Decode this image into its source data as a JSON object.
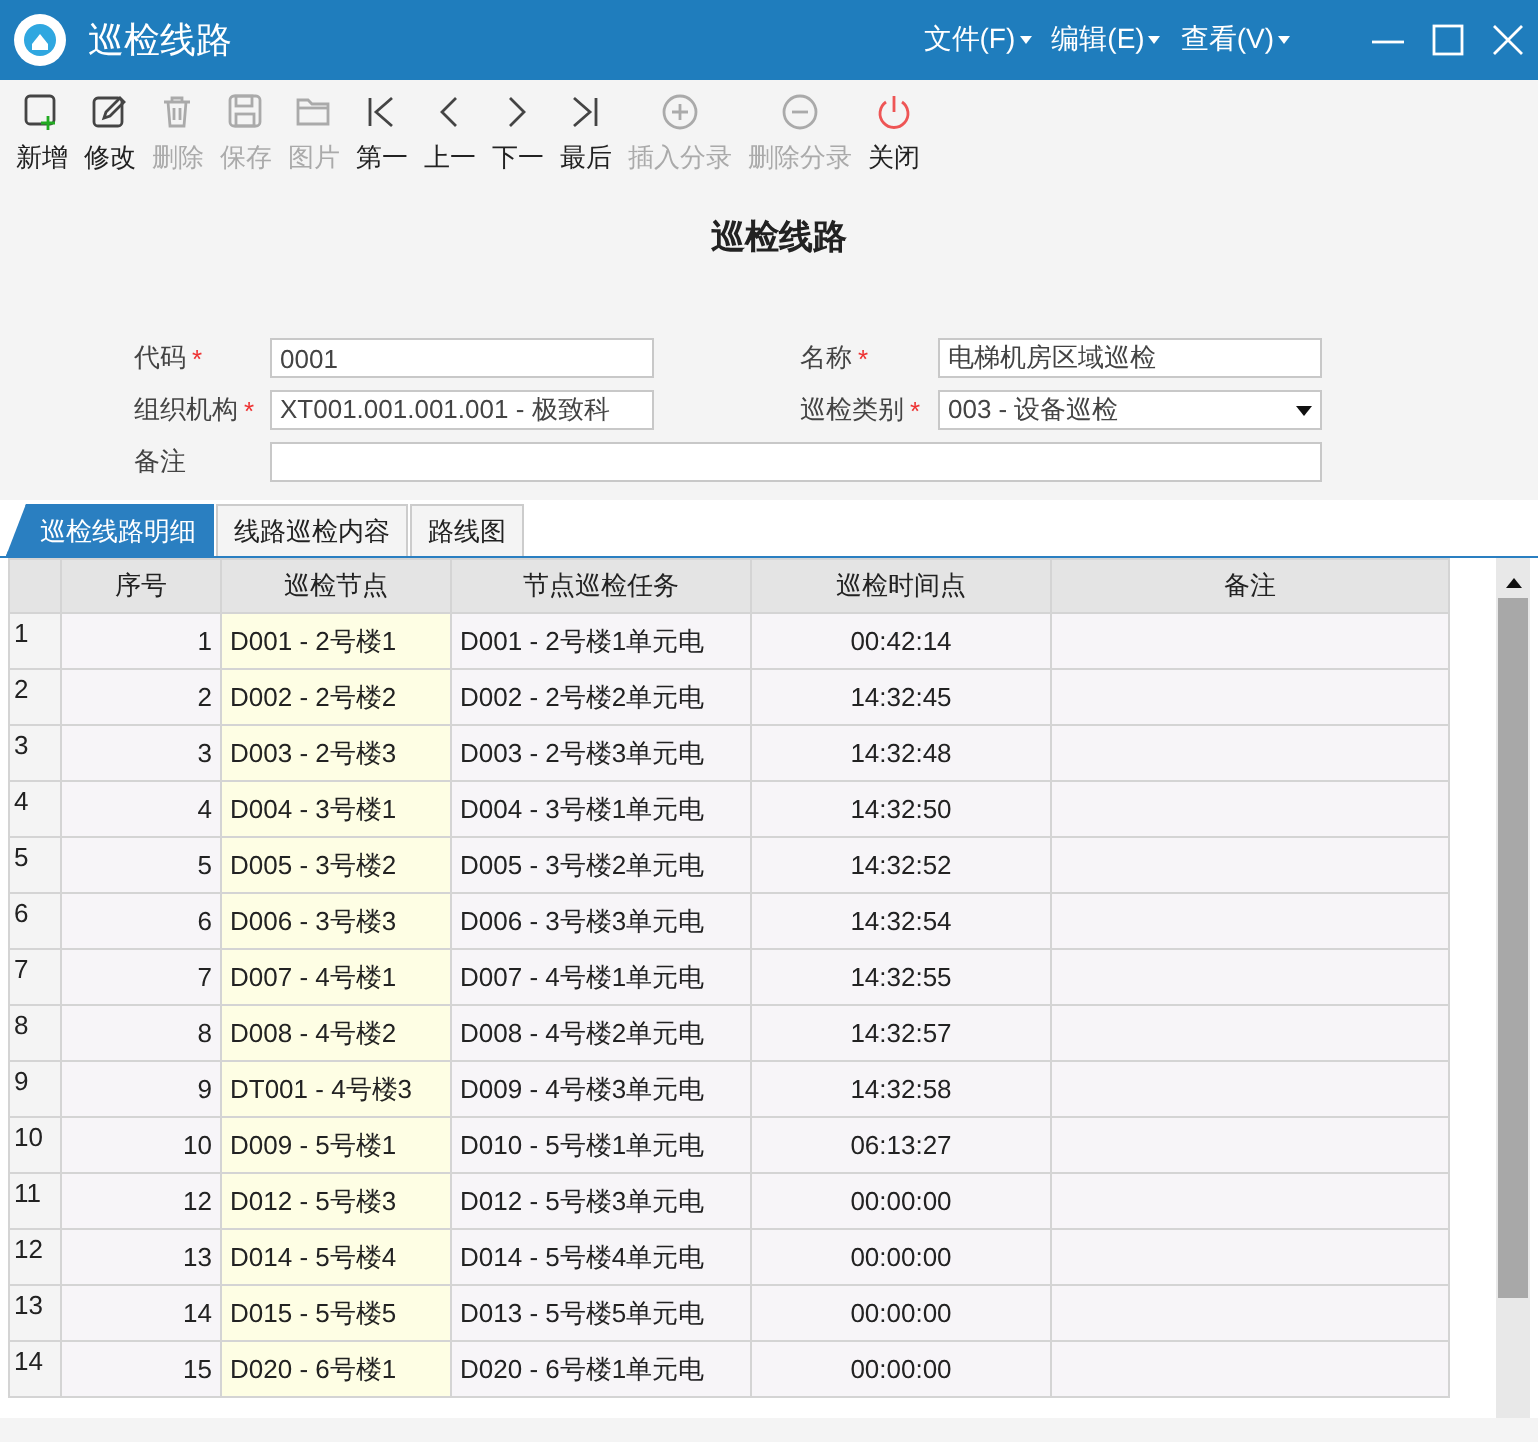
{
  "window": {
    "title": "巡检线路",
    "menus": [
      "文件(F)",
      "编辑(E)",
      "查看(V)"
    ]
  },
  "toolbar": [
    {
      "label": "新增",
      "disabled": false
    },
    {
      "label": "修改",
      "disabled": false
    },
    {
      "label": "删除",
      "disabled": true
    },
    {
      "label": "保存",
      "disabled": true
    },
    {
      "label": "图片",
      "disabled": true
    },
    {
      "label": "第一",
      "disabled": false
    },
    {
      "label": "上一",
      "disabled": false
    },
    {
      "label": "下一",
      "disabled": false
    },
    {
      "label": "最后",
      "disabled": false
    },
    {
      "label": "插入分录",
      "disabled": true
    },
    {
      "label": "删除分录",
      "disabled": true
    },
    {
      "label": "关闭",
      "disabled": false
    }
  ],
  "heading": "巡检线路",
  "form": {
    "fields": [
      {
        "label": "代码",
        "required_mark": "*",
        "value": "0001",
        "kind": "text"
      },
      {
        "label": "名称",
        "required_mark": "*",
        "value": "电梯机房区域巡检",
        "kind": "text"
      },
      {
        "label": "组织机构",
        "required_mark": "*",
        "value": "XT001.001.001.001  - 极致科",
        "kind": "text"
      },
      {
        "label": "巡检类别",
        "required_mark": "*",
        "value": "003 - 设备巡检",
        "kind": "select"
      },
      {
        "label": "备注",
        "kind": "wide"
      }
    ]
  },
  "tabs": [
    {
      "label": "巡检线路明细",
      "selected": true
    },
    {
      "label": "线路巡检内容",
      "selected": false
    },
    {
      "label": "路线图",
      "selected": false
    }
  ],
  "table": {
    "columns": [
      "序号",
      "巡检节点",
      "节点巡检任务",
      "巡检时间点",
      "备注"
    ],
    "rows": [
      {
        "row_header": "1",
        "seq": "1",
        "node": "D001 - 2号楼1",
        "task": "D001 - 2号楼1单元电",
        "time": "00:42:14"
      },
      {
        "row_header": "2",
        "seq": "2",
        "node": "D002 - 2号楼2",
        "task": "D002 - 2号楼2单元电",
        "time": "14:32:45"
      },
      {
        "row_header": "3",
        "seq": "3",
        "node": "D003 - 2号楼3",
        "task": "D003 - 2号楼3单元电",
        "time": "14:32:48"
      },
      {
        "row_header": "4",
        "seq": "4",
        "node": "D004 - 3号楼1",
        "task": "D004 - 3号楼1单元电",
        "time": "14:32:50"
      },
      {
        "row_header": "5",
        "seq": "5",
        "node": "D005 - 3号楼2",
        "task": "D005 - 3号楼2单元电",
        "time": "14:32:52"
      },
      {
        "row_header": "6",
        "seq": "6",
        "node": "D006 - 3号楼3",
        "task": "D006 - 3号楼3单元电",
        "time": "14:32:54"
      },
      {
        "row_header": "7",
        "seq": "7",
        "node": "D007 - 4号楼1",
        "task": "D007 - 4号楼1单元电",
        "time": "14:32:55"
      },
      {
        "row_header": "8",
        "seq": "8",
        "node": "D008 - 4号楼2",
        "task": "D008 - 4号楼2单元电",
        "time": "14:32:57"
      },
      {
        "row_header": "9",
        "seq": "9",
        "node": "DT001 - 4号楼3",
        "task": "D009 - 4号楼3单元电",
        "time": "14:32:58"
      },
      {
        "row_header": "10",
        "seq": "10",
        "node": "D009 - 5号楼1",
        "task": "D010 - 5号楼1单元电",
        "time": "06:13:27"
      },
      {
        "row_header": "11",
        "seq": "12",
        "node": "D012 - 5号楼3",
        "task": "D012 - 5号楼3单元电",
        "time": "00:00:00"
      },
      {
        "row_header": "12",
        "seq": "13",
        "node": "D014 - 5号楼4",
        "task": "D014 - 5号楼4单元电",
        "time": "00:00:00"
      },
      {
        "row_header": "13",
        "seq": "14",
        "node": "D015 - 5号楼5",
        "task": "D013 - 5号楼5单元电",
        "time": "00:00:00"
      },
      {
        "row_header": "14",
        "seq": "15",
        "node": "D020 - 6号楼1",
        "task": "D020 - 6号楼1单元电",
        "time": "00:00:00"
      }
    ]
  }
}
